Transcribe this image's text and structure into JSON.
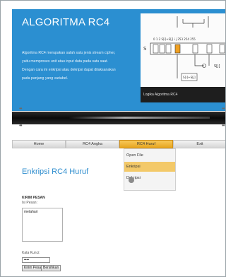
{
  "hero": {
    "title": "ALGORITMA RC4",
    "paragraph_lines": [
      "Algoritma RC4 merupakan salah satu jenis stream cipher,",
      "yaitu memproses unit atau input data pada satu saat.",
      "Dengan cara ini enkripsi atau dekripsi dapat dilaksanakan",
      "pada panjang yang variabel."
    ],
    "diagram": {
      "s_label": "S",
      "index_row": "0  1  2    S[i]+S[j]    i      j          253 254 255",
      "right_label": "S[j]",
      "bottom_label": "S[i]+S[j]"
    },
    "caption": "Logika Algoritma RC4"
  },
  "strip": {
    "left_dots": "••",
    "right_dots": "••"
  },
  "nav": {
    "items": [
      "Home",
      "RC4 Angka",
      "RC4 Huruf",
      "Exit"
    ],
    "active": "RC4 Huruf"
  },
  "dropdown": {
    "items": [
      "Open File",
      "Enkripsi",
      "Dekripsi"
    ],
    "highlighted": "Enkripsi"
  },
  "main": {
    "title": "Enkripsi RC4 Huruf",
    "section_label": "KIRIM PESAN",
    "message_label": "Isi Pesan:",
    "message_value": "metahari",
    "key_label": "Kata Kunci:",
    "key_value": "••••",
    "send_button": "Kirim Pesan",
    "reset_button": "Bersihkan"
  },
  "colors": {
    "hero_bg": "#2b8fd1",
    "accent_text": "#2e8dce",
    "active_tab": "#f0b83b",
    "hover_item": "#f3c969"
  }
}
